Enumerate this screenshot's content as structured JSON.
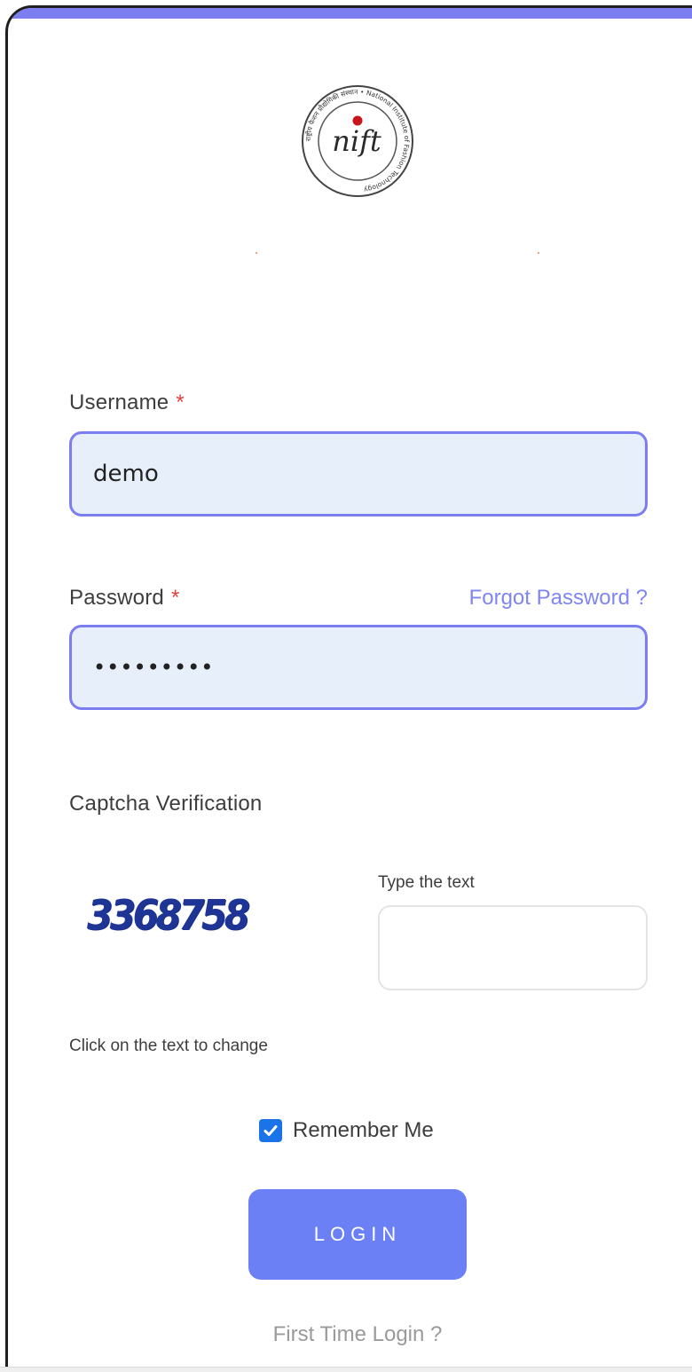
{
  "logo": {
    "initials": "nift",
    "ring_text": "राष्ट्रीय फैशन प्रौद्योगिकी संस्थान • National Institute of Fashion Technology"
  },
  "form": {
    "username": {
      "label": "Username",
      "required_mark": "*",
      "value": "demo"
    },
    "password": {
      "label": "Password",
      "required_mark": "*",
      "value": "•••••••••",
      "forgot_link": "Forgot Password ?"
    },
    "captcha": {
      "section_label": "Captcha Verification",
      "code": "3368758",
      "input_label": "Type the text",
      "input_value": "",
      "hint": "Click on the text to change"
    },
    "remember_me": {
      "label": "Remember Me",
      "checked": true
    },
    "login_button": "LOGIN",
    "first_time_link": "First Time Login ?"
  },
  "colors": {
    "accent": "#7c7ef0",
    "input_bg": "#e7effa",
    "button": "#6b80f5",
    "required": "#e0413c",
    "link": "#7f86f2",
    "captcha": "#1f3596"
  },
  "icons": {
    "checkbox": "check-icon"
  }
}
